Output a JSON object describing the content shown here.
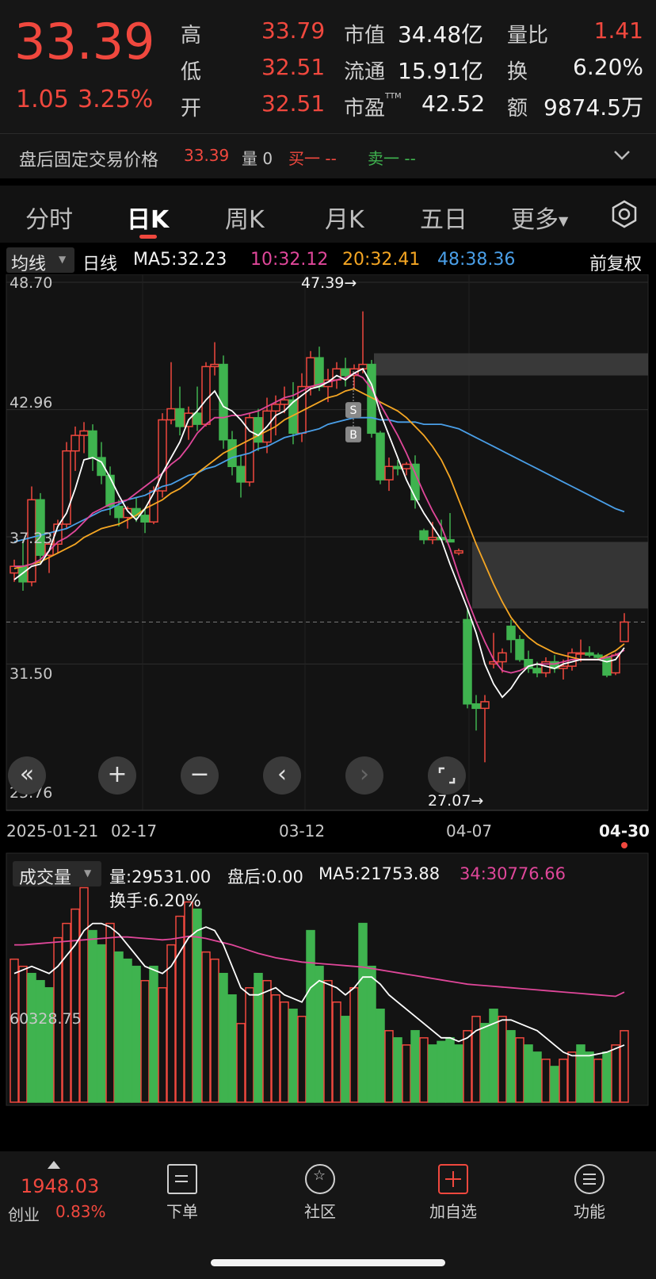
{
  "quote": {
    "price": "33.39",
    "change": "1.05",
    "change_pct": "3.25%",
    "stats": [
      {
        "label": "高",
        "value": "33.79"
      },
      {
        "label": "低",
        "value": "32.51"
      },
      {
        "label": "开",
        "value": "32.51"
      }
    ],
    "market_cap_label": "市值",
    "market_cap": "34.48亿",
    "float_label": "流通",
    "float": "15.91亿",
    "pe_label": "市盈",
    "pe_sup": "TTM",
    "pe": "42.52",
    "vol_ratio_label": "量比",
    "vol_ratio": "1.41",
    "turnover_label": "换",
    "turnover": "6.20%",
    "amount_label": "额",
    "amount": "9874.5万"
  },
  "after_hours": {
    "label": "盘后固定交易价格",
    "price": "33.39",
    "volume": "量 0",
    "buy": "买一 --",
    "sell": "卖一 --",
    "toggle_icon": "chevron-down-icon"
  },
  "tabs": [
    "分时",
    "日K",
    "周K",
    "月K",
    "五日"
  ],
  "tabs_more": "更多",
  "active_tab": "日K",
  "indicator": {
    "selector": "均线",
    "period": "日线",
    "ma5": "MA5:32.23",
    "ma10": "10:32.12",
    "ma20": "20:32.41",
    "ma48": "48:38.36",
    "adjust": "前复权"
  },
  "price_axis": [
    "48.70",
    "42.96",
    "37.23",
    "31.50",
    "25.76"
  ],
  "date_axis": [
    "2025-01-21",
    "02-17",
    "03-12",
    "04-07",
    "04-30"
  ],
  "annotations": {
    "high": "47.39→",
    "low": "27.07→",
    "sell_marker": "S",
    "buy_marker": "B"
  },
  "volume_panel": {
    "selector": "成交量",
    "vol": "量:29531.00",
    "after": "盘后:0.00",
    "ma5": "MA5:21753.88",
    "ma34": "34:30776.66",
    "turnover": "换手:6.20%",
    "axis_label": "60328.75"
  },
  "bottom_nav": {
    "index_value": "1948.03",
    "index_name": "创业",
    "index_pct": "0.83%",
    "items": [
      "下单",
      "社区",
      "加自选",
      "功能"
    ]
  },
  "colors": {
    "up": "#f0483e",
    "down": "#3fb34f",
    "ma5": "#ffffff",
    "ma10": "#e0479a",
    "ma20": "#f5a623",
    "ma48": "#4a9fe8"
  },
  "chart_data": {
    "type": "candlestick",
    "y_range": [
      25.76,
      48.7
    ],
    "x_start": "2025-01-21",
    "x_end": "2025-04-30",
    "ohlc": [
      [
        35.6,
        36.2,
        35.2,
        35.9
      ],
      [
        35.9,
        37.1,
        34.8,
        35.2
      ],
      [
        35.2,
        39.5,
        35.0,
        38.9
      ],
      [
        38.9,
        39.2,
        36.0,
        36.4
      ],
      [
        36.4,
        37.0,
        35.6,
        36.9
      ],
      [
        36.9,
        38.0,
        36.5,
        37.8
      ],
      [
        37.8,
        41.5,
        37.6,
        41.1
      ],
      [
        41.1,
        42.2,
        40.2,
        41.8
      ],
      [
        41.8,
        42.4,
        41.0,
        42.0
      ],
      [
        42.0,
        42.3,
        40.2,
        40.8
      ],
      [
        40.8,
        41.5,
        39.6,
        40.0
      ],
      [
        40.0,
        40.4,
        38.2,
        38.6
      ],
      [
        38.6,
        38.9,
        37.7,
        38.1
      ],
      [
        38.1,
        38.6,
        37.6,
        38.5
      ],
      [
        38.5,
        39.0,
        37.9,
        38.2
      ],
      [
        38.2,
        38.5,
        37.4,
        37.9
      ],
      [
        37.9,
        39.5,
        37.8,
        39.3
      ],
      [
        39.3,
        42.8,
        39.0,
        42.5
      ],
      [
        42.5,
        45.1,
        42.3,
        43.0
      ],
      [
        43.0,
        44.0,
        41.8,
        42.2
      ],
      [
        42.2,
        43.1,
        41.6,
        42.8
      ],
      [
        42.8,
        44.0,
        42.0,
        42.3
      ],
      [
        42.3,
        45.1,
        42.2,
        44.9
      ],
      [
        44.9,
        46.0,
        44.5,
        45.0
      ],
      [
        45.0,
        45.4,
        41.2,
        41.6
      ],
      [
        41.6,
        42.0,
        40.0,
        40.4
      ],
      [
        40.4,
        40.9,
        39.0,
        39.7
      ],
      [
        39.7,
        42.8,
        39.5,
        42.6
      ],
      [
        42.6,
        43.0,
        41.1,
        41.5
      ],
      [
        41.5,
        43.5,
        41.0,
        42.9
      ],
      [
        42.9,
        43.6,
        41.8,
        43.2
      ],
      [
        43.2,
        44.0,
        42.8,
        43.4
      ],
      [
        43.4,
        44.2,
        41.4,
        41.9
      ],
      [
        41.9,
        44.6,
        41.5,
        44.0
      ],
      [
        44.0,
        45.6,
        43.6,
        45.3
      ],
      [
        45.3,
        45.8,
        43.8,
        44.0
      ],
      [
        44.0,
        44.8,
        43.3,
        44.3
      ],
      [
        44.3,
        45.1,
        43.9,
        44.8
      ],
      [
        44.8,
        45.3,
        44.0,
        44.5
      ],
      [
        44.5,
        45.0,
        43.9,
        44.8
      ],
      [
        44.8,
        47.39,
        44.6,
        45.0
      ],
      [
        45.0,
        45.2,
        41.7,
        41.9
      ],
      [
        41.9,
        42.0,
        39.6,
        39.8
      ],
      [
        39.8,
        40.8,
        39.3,
        40.4
      ],
      [
        40.4,
        40.7,
        40.0,
        40.3
      ],
      [
        40.3,
        40.6,
        40.0,
        40.5
      ],
      [
        40.5,
        40.9,
        38.5,
        38.9
      ],
      [
        37.5,
        37.6,
        36.9,
        37.1
      ],
      [
        37.1,
        37.9,
        36.9,
        37.2
      ],
      [
        37.2,
        38.0,
        37.1,
        37.1
      ],
      [
        37.1,
        38.3,
        37.0,
        37.0
      ],
      [
        36.5,
        36.7,
        36.4,
        36.6
      ],
      [
        33.5,
        34.0,
        29.5,
        29.7
      ],
      [
        29.7,
        30.1,
        28.5,
        29.5
      ],
      [
        29.5,
        30.1,
        27.07,
        29.8
      ],
      [
        31.5,
        32.9,
        31.3,
        31.6
      ],
      [
        31.6,
        32.2,
        31.1,
        32.0
      ],
      [
        33.2,
        33.5,
        32.0,
        32.6
      ],
      [
        32.6,
        32.8,
        31.6,
        31.7
      ],
      [
        31.7,
        32.1,
        31.1,
        31.3
      ],
      [
        31.3,
        31.6,
        30.9,
        31.1
      ],
      [
        31.1,
        31.8,
        30.9,
        31.6
      ],
      [
        31.6,
        31.9,
        31.1,
        31.3
      ],
      [
        31.3,
        31.7,
        30.8,
        31.4
      ],
      [
        31.4,
        32.2,
        31.2,
        32.0
      ],
      [
        32.0,
        32.6,
        31.6,
        32.0
      ],
      [
        32.0,
        32.3,
        31.8,
        31.9
      ],
      [
        31.9,
        32.0,
        31.7,
        31.8
      ],
      [
        31.8,
        31.9,
        30.9,
        31.0
      ],
      [
        31.1,
        32.0,
        31.0,
        31.9
      ],
      [
        32.51,
        33.79,
        32.51,
        33.39
      ]
    ],
    "ma5": [
      35.3,
      35.6,
      35.9,
      36.0,
      36.6,
      37.7,
      38.3,
      39.4,
      40.7,
      40.8,
      40.6,
      39.9,
      39.1,
      38.4,
      38.0,
      38.5,
      39.2,
      40.1,
      40.8,
      41.5,
      42.5,
      42.9,
      43.4,
      43.8,
      43.1,
      42.9,
      42.5,
      42.0,
      41.8,
      42.2,
      42.7,
      42.9,
      43.3,
      43.6,
      43.9,
      44.0,
      44.2,
      44.5,
      44.3,
      44.6,
      44.8,
      44.1,
      42.8,
      41.8,
      40.8,
      39.8,
      39.0,
      38.3,
      37.7,
      37.1,
      36.0,
      35.0,
      34.0,
      32.9,
      31.5,
      30.6,
      30.0,
      30.4,
      31.0,
      31.4,
      31.5,
      31.4,
      31.3,
      31.5,
      31.6,
      31.7,
      31.7,
      31.7,
      31.6,
      31.7,
      32.23
    ],
    "ma10": [
      35.9,
      35.9,
      36.0,
      36.2,
      36.6,
      37.0,
      37.2,
      37.5,
      37.9,
      38.3,
      38.5,
      38.7,
      38.8,
      38.9,
      39.2,
      39.5,
      39.8,
      40.1,
      40.5,
      40.8,
      41.3,
      41.9,
      42.3,
      42.6,
      42.6,
      42.7,
      42.7,
      42.8,
      42.9,
      43.1,
      43.3,
      43.5,
      43.6,
      43.8,
      44.0,
      44.1,
      44.2,
      44.3,
      44.4,
      44.6,
      44.4,
      43.9,
      43.2,
      42.5,
      41.8,
      41.0,
      40.1,
      39.2,
      38.4,
      37.7,
      36.7,
      35.5,
      34.4,
      33.4,
      32.5,
      31.7,
      31.2,
      31.1,
      31.2,
      31.4,
      31.5,
      31.5,
      31.5,
      31.6,
      31.7,
      31.7,
      31.7,
      31.7,
      31.8,
      31.9,
      32.12
    ],
    "ma20": [
      35.8,
      35.9,
      36.0,
      36.1,
      36.3,
      36.5,
      36.7,
      36.9,
      37.2,
      37.4,
      37.6,
      37.7,
      37.8,
      38.0,
      38.2,
      38.5,
      38.7,
      38.9,
      39.2,
      39.4,
      39.7,
      40.1,
      40.4,
      40.7,
      41.0,
      41.2,
      41.4,
      41.6,
      41.8,
      42.0,
      42.2,
      42.5,
      42.7,
      42.9,
      43.1,
      43.3,
      43.5,
      43.6,
      43.8,
      43.9,
      43.7,
      43.5,
      43.3,
      43.1,
      42.9,
      42.6,
      42.2,
      41.8,
      41.3,
      40.7,
      39.9,
      38.9,
      37.9,
      36.9,
      36.0,
      35.1,
      34.3,
      33.6,
      33.1,
      32.7,
      32.4,
      32.2,
      32.0,
      31.9,
      31.8,
      31.7,
      31.7,
      31.7,
      31.9,
      32.1,
      32.41
    ],
    "ma48": [
      37.0,
      37.1,
      37.2,
      37.3,
      37.4,
      37.5,
      37.6,
      37.8,
      38.0,
      38.2,
      38.4,
      38.5,
      38.7,
      38.9,
      39.0,
      39.1,
      39.3,
      39.5,
      39.6,
      39.8,
      40.0,
      40.1,
      40.3,
      40.4,
      40.6,
      40.8,
      40.9,
      41.0,
      41.2,
      41.3,
      41.5,
      41.7,
      41.8,
      41.9,
      42.0,
      42.1,
      42.3,
      42.4,
      42.5,
      42.6,
      42.6,
      42.6,
      42.5,
      42.5,
      42.4,
      42.4,
      42.4,
      42.3,
      42.3,
      42.3,
      42.2,
      42.1,
      41.9,
      41.7,
      41.5,
      41.3,
      41.1,
      40.9,
      40.7,
      40.5,
      40.3,
      40.1,
      39.9,
      39.7,
      39.5,
      39.3,
      39.1,
      38.9,
      38.7,
      38.5,
      38.36
    ],
    "volume_range": [
      0,
      60328.75
    ],
    "volume": [
      40000,
      38000,
      36000,
      34000,
      32000,
      46000,
      50000,
      54000,
      60000,
      48000,
      44000,
      50000,
      42000,
      40000,
      38000,
      34000,
      38000,
      32000,
      44000,
      52000,
      56000,
      54000,
      42000,
      40000,
      36000,
      30000,
      22000,
      32000,
      36000,
      34000,
      30000,
      28000,
      26000,
      24000,
      48000,
      38000,
      34000,
      28000,
      24000,
      32000,
      50000,
      38000,
      26000,
      20000,
      18000,
      16000,
      20000,
      18000,
      16000,
      17000,
      18000,
      16000,
      20000,
      24000,
      22000,
      26000,
      24000,
      20000,
      18000,
      16000,
      14000,
      12000,
      10000,
      12000,
      14000,
      16000,
      14000,
      12000,
      14000,
      16000,
      20000
    ],
    "volume_up": [
      true,
      true,
      false,
      false,
      false,
      true,
      true,
      true,
      true,
      false,
      false,
      true,
      false,
      false,
      false,
      true,
      false,
      true,
      true,
      true,
      true,
      false,
      true,
      true,
      false,
      false,
      true,
      true,
      false,
      true,
      true,
      true,
      false,
      true,
      false,
      false,
      true,
      true,
      false,
      true,
      false,
      false,
      false,
      true,
      false,
      true,
      false,
      true,
      false,
      false,
      false,
      false,
      true,
      true,
      false,
      false,
      true,
      false,
      true,
      false,
      false,
      true,
      false,
      true,
      true,
      false,
      false,
      true,
      false,
      true,
      true
    ],
    "vol_ma5": [
      36000,
      37000,
      38000,
      37000,
      36000,
      38000,
      41000,
      44000,
      48000,
      50000,
      50000,
      49000,
      47000,
      44000,
      41000,
      38000,
      37000,
      36000,
      38000,
      42000,
      46000,
      48000,
      49000,
      48000,
      44000,
      38000,
      32000,
      30000,
      30000,
      31000,
      32000,
      30000,
      29000,
      28000,
      32000,
      34000,
      33000,
      32000,
      30000,
      32000,
      35000,
      35000,
      33000,
      30000,
      28000,
      26000,
      24000,
      22000,
      20000,
      18000,
      18000,
      17000,
      18000,
      20000,
      21000,
      22000,
      23000,
      23000,
      22000,
      21000,
      20000,
      18000,
      16000,
      14000,
      13000,
      13000,
      13000,
      13500,
      14000,
      15000,
      16000
    ],
    "vol_ma34": [
      44000,
      44000,
      44200,
      44400,
      44600,
      44800,
      45000,
      45200,
      45400,
      45600,
      45800,
      46000,
      46200,
      46200,
      46000,
      45800,
      45600,
      45400,
      45600,
      46000,
      46400,
      46200,
      45800,
      45200,
      44600,
      44000,
      43200,
      42400,
      41600,
      41000,
      40400,
      40000,
      39600,
      39200,
      39000,
      38800,
      38600,
      38400,
      38200,
      38000,
      37800,
      37400,
      37000,
      36600,
      36200,
      35800,
      35400,
      35000,
      34600,
      34200,
      33800,
      33400,
      33000,
      32800,
      32600,
      32400,
      32200,
      32000,
      31800,
      31600,
      31400,
      31200,
      31000,
      30800,
      30600,
      30400,
      30200,
      30000,
      29800,
      29600,
      30776.66
    ]
  }
}
